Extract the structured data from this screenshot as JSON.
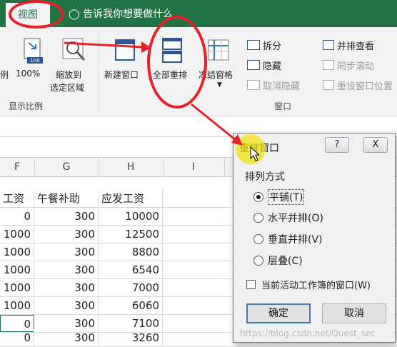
{
  "ribbon": {
    "active_tab": "视图",
    "tell_me": "告诉我你想要做什么",
    "zoom_buttons": [
      {
        "label": "例"
      },
      {
        "label": "100%",
        "badge": "100"
      },
      {
        "label_line1": "缩放到",
        "label_line2": "选定区域"
      }
    ],
    "zoom_group_label": "显示比例",
    "new_window": "新建窗口",
    "arrange_all": "全部重排",
    "freeze_panes": "冻结窗格",
    "split": "拆分",
    "hide": "隐藏",
    "unhide": "取消隐藏",
    "view_side_by_side": "并排查看",
    "sync_scroll": "同步滚动",
    "reset_position": "重设窗口位置",
    "window_group_label": "窗口"
  },
  "sheet": {
    "columns": [
      "F",
      "G",
      "H",
      "I"
    ],
    "headers": [
      "工资",
      "午餐补助",
      "应发工资"
    ],
    "rows": [
      [
        "0",
        "300",
        "10000"
      ],
      [
        "1000",
        "300",
        "12500"
      ],
      [
        "1000",
        "300",
        "8800"
      ],
      [
        "1000",
        "300",
        "6540"
      ],
      [
        "1000",
        "300",
        "7000"
      ],
      [
        "1000",
        "300",
        "6060"
      ],
      [
        "0",
        "300",
        "7100"
      ],
      [
        "0",
        "300",
        "3260"
      ]
    ]
  },
  "dialog": {
    "title": "重排窗口",
    "help": "?",
    "close": "X",
    "group_label": "排列方式",
    "options": [
      "平铺(T)",
      "水平并排(O)",
      "垂直并排(V)",
      "层叠(C)"
    ],
    "selected_option": "平铺(T)",
    "checkbox_label": "当前活动工作簿的窗口(W)",
    "ok": "确定",
    "cancel": "取消"
  },
  "watermark": "https://blog.csdn.net/Quest_sec",
  "colors": {
    "ribbon_green": "#217346",
    "annotation_red": "#e8202a",
    "dialog_bg": "#f0f0f0"
  }
}
